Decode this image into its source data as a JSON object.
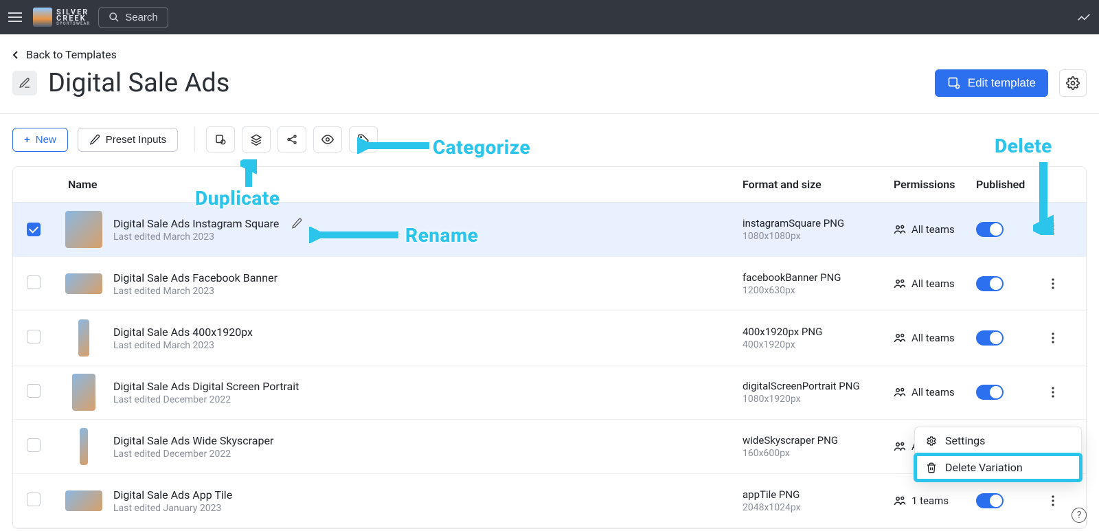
{
  "brand": {
    "line1": "SILVER",
    "line2": "CREEK",
    "sub": "SPORTSWEAR"
  },
  "topbar": {
    "search": "Search"
  },
  "back_link": "Back to Templates",
  "page_title": "Digital Sale Ads",
  "edit_template_btn": "Edit template",
  "action_row": {
    "new": "New",
    "preset": "Preset Inputs"
  },
  "annotations": {
    "categorize": "Categorize",
    "duplicate": "Duplicate",
    "rename": "Rename",
    "delete": "Delete"
  },
  "columns": {
    "name": "Name",
    "format": "Format and size",
    "permissions": "Permissions",
    "published": "Published"
  },
  "rows": [
    {
      "name": "Digital Sale Ads Instagram Square",
      "edited": "Last edited March 2023",
      "format": "instagramSquare PNG",
      "size": "1080x1080px",
      "perm": "All teams",
      "selected": true,
      "thumb": "square"
    },
    {
      "name": "Digital Sale Ads Facebook Banner",
      "edited": "Last edited March 2023",
      "format": "facebookBanner PNG",
      "size": "1200x630px",
      "perm": "All teams",
      "selected": false,
      "thumb": "banner"
    },
    {
      "name": "Digital Sale Ads 400x1920px",
      "edited": "Last edited March 2023",
      "format": "400x1920px PNG",
      "size": "400x1920px",
      "perm": "All teams",
      "selected": false,
      "thumb": "sky"
    },
    {
      "name": "Digital Sale Ads Digital Screen Portrait",
      "edited": "Last edited December 2022",
      "format": "digitalScreenPortrait PNG",
      "size": "1080x1920px",
      "perm": "All teams",
      "selected": false,
      "thumb": "port"
    },
    {
      "name": "Digital Sale Ads Wide Skyscraper",
      "edited": "Last edited December 2022",
      "format": "wideSkyscraper PNG",
      "size": "160x600px",
      "perm": "All teams",
      "selected": false,
      "thumb": "skyw"
    },
    {
      "name": "Digital Sale Ads App Tile",
      "edited": "Last edited January 2023",
      "format": "appTile PNG",
      "size": "2048x1024px",
      "perm": "1 teams",
      "selected": false,
      "thumb": "tile"
    }
  ],
  "dropdown": {
    "settings": "Settings",
    "delete": "Delete Variation"
  }
}
